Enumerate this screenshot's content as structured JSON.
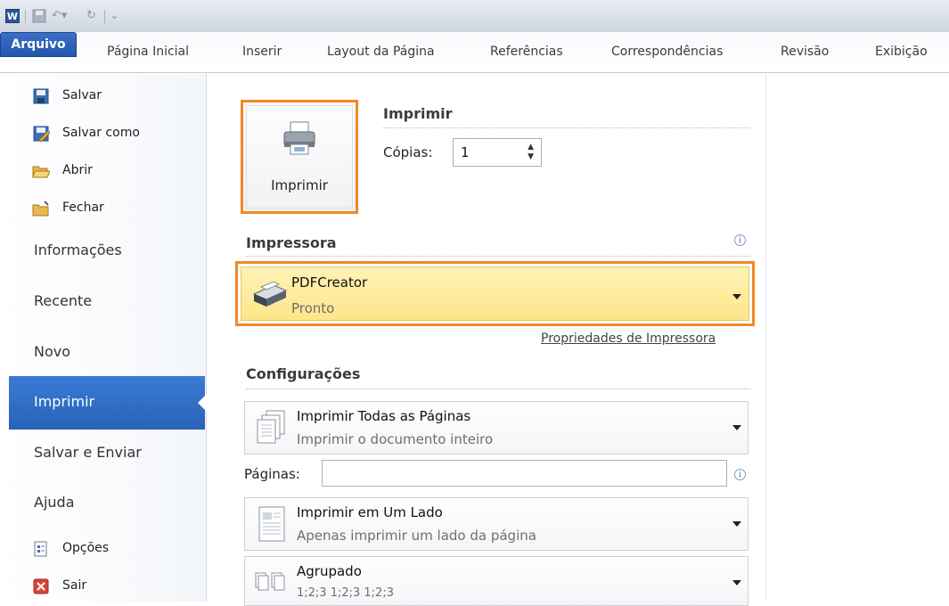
{
  "titlebar": {
    "app_icon_letter": "W"
  },
  "tabs": {
    "file": "Arquivo",
    "items": [
      "Página Inicial",
      "Inserir",
      "Layout da Página",
      "Referências",
      "Correspondências",
      "Revisão",
      "Exibição"
    ]
  },
  "leftnav": {
    "commands": [
      {
        "label": "Salvar",
        "icon": "save-icon"
      },
      {
        "label": "Salvar como",
        "icon": "save-as-icon"
      },
      {
        "label": "Abrir",
        "icon": "open-folder-icon"
      },
      {
        "label": "Fechar",
        "icon": "close-folder-icon"
      }
    ],
    "sections": [
      "Informações",
      "Recente",
      "Novo",
      "Imprimir",
      "Salvar e Enviar",
      "Ajuda"
    ],
    "bottom": [
      {
        "label": "Opções",
        "icon": "options-icon"
      },
      {
        "label": "Sair",
        "icon": "exit-icon"
      }
    ]
  },
  "print": {
    "heading": "Imprimir",
    "button_label": "Imprimir",
    "copies_label": "Cópias:",
    "copies_value": "1"
  },
  "printer": {
    "heading": "Impressora",
    "name": "PDFCreator",
    "status": "Pronto",
    "properties_link": "Propriedades de Impressora"
  },
  "settings": {
    "heading": "Configurações",
    "range": {
      "title": "Imprimir Todas as Páginas",
      "subtitle": "Imprimir o documento inteiro"
    },
    "pages_label": "Páginas:",
    "pages_value": "",
    "sides": {
      "title": "Imprimir em Um Lado",
      "subtitle": "Apenas imprimir um lado da página"
    },
    "collate": {
      "title": "Agrupado",
      "subtitle": "1;2;3   1;2;3   1;2;3"
    }
  },
  "colors": {
    "accent": "#2a62b8",
    "highlight_border": "#f08a24",
    "printer_fill": "#fde58a"
  }
}
